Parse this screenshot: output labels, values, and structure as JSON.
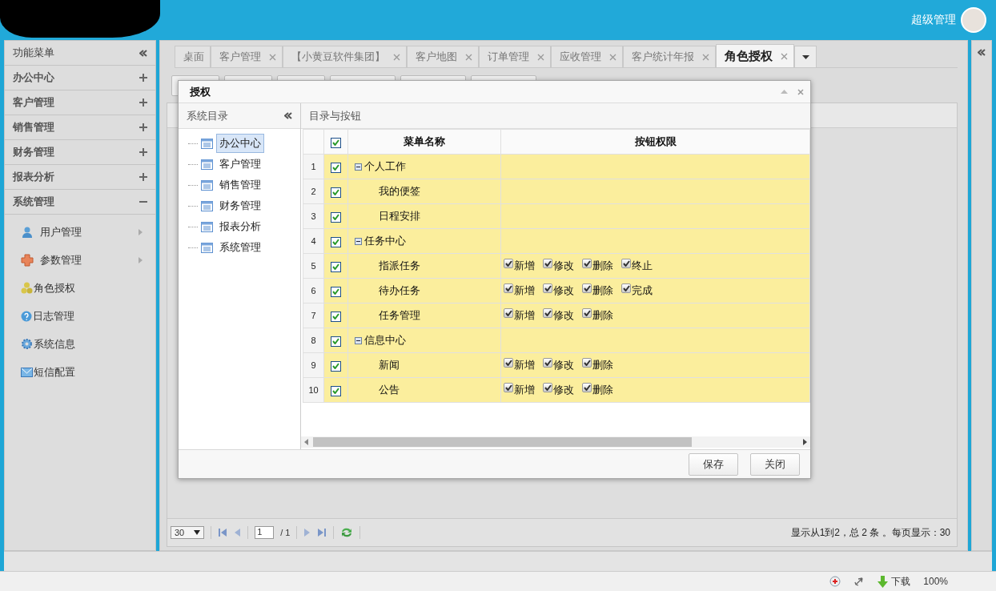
{
  "header": {
    "user": "超级管理"
  },
  "sidebar": {
    "title": "功能菜单",
    "groups": [
      {
        "label": "办公中心",
        "expanded": false
      },
      {
        "label": "客户管理",
        "expanded": false
      },
      {
        "label": "销售管理",
        "expanded": false
      },
      {
        "label": "财务管理",
        "expanded": false
      },
      {
        "label": "报表分析",
        "expanded": false
      },
      {
        "label": "系统管理",
        "expanded": true,
        "items": [
          {
            "label": "用户管理",
            "submenu": true
          },
          {
            "label": "参数管理",
            "submenu": true
          },
          {
            "label": "角色授权",
            "submenu": false
          },
          {
            "label": "日志管理",
            "submenu": false
          },
          {
            "label": "系统信息",
            "submenu": false
          },
          {
            "label": "短信配置",
            "submenu": false
          }
        ]
      }
    ]
  },
  "tabs": [
    {
      "label": "桌面",
      "closable": false,
      "selected": false
    },
    {
      "label": "客户管理",
      "closable": true,
      "selected": false
    },
    {
      "label": "【小黄豆软件集团】",
      "closable": true,
      "selected": false
    },
    {
      "label": "客户地图",
      "closable": true,
      "selected": false
    },
    {
      "label": "订单管理",
      "closable": true,
      "selected": false
    },
    {
      "label": "应收管理",
      "closable": true,
      "selected": false
    },
    {
      "label": "客户统计年报",
      "closable": true,
      "selected": false
    },
    {
      "label": "角色授权",
      "closable": true,
      "selected": true
    }
  ],
  "pager": {
    "page_size": "30",
    "page": "1",
    "total_pages": "/ 1",
    "summary": "显示从1到2，总 2 条 。每页显示：30"
  },
  "dialog": {
    "title": "授权",
    "tree": {
      "title": "系统目录",
      "items": [
        {
          "label": "办公中心",
          "selected": true
        },
        {
          "label": "客户管理",
          "selected": false
        },
        {
          "label": "销售管理",
          "selected": false
        },
        {
          "label": "财务管理",
          "selected": false
        },
        {
          "label": "报表分析",
          "selected": false
        },
        {
          "label": "系统管理",
          "selected": false
        }
      ]
    },
    "grid": {
      "title": "目录与按钮",
      "all_checked": true,
      "columns": [
        "菜单名称",
        "按钮权限"
      ],
      "rows": [
        {
          "number": "1",
          "checked": true,
          "kind": "group",
          "expanded": true,
          "name": "个人工作"
        },
        {
          "number": "2",
          "checked": true,
          "kind": "leaf",
          "name": "我的便签"
        },
        {
          "number": "3",
          "checked": true,
          "kind": "leaf",
          "name": "日程安排"
        },
        {
          "number": "4",
          "checked": true,
          "kind": "group",
          "expanded": true,
          "name": "任务中心"
        },
        {
          "number": "5",
          "checked": true,
          "kind": "leaf",
          "name": "指派任务",
          "buttons": [
            {
              "label": "新增",
              "checked": true
            },
            {
              "label": "修改",
              "checked": true
            },
            {
              "label": "删除",
              "checked": true
            },
            {
              "label": "终止",
              "checked": true
            }
          ]
        },
        {
          "number": "6",
          "checked": true,
          "kind": "leaf",
          "name": "待办任务",
          "buttons": [
            {
              "label": "新增",
              "checked": true
            },
            {
              "label": "修改",
              "checked": true
            },
            {
              "label": "删除",
              "checked": true
            },
            {
              "label": "完成",
              "checked": true
            }
          ]
        },
        {
          "number": "7",
          "checked": true,
          "kind": "leaf",
          "name": "任务管理",
          "buttons": [
            {
              "label": "新增",
              "checked": true
            },
            {
              "label": "修改",
              "checked": true
            },
            {
              "label": "删除",
              "checked": true
            }
          ]
        },
        {
          "number": "8",
          "checked": true,
          "kind": "group",
          "expanded": true,
          "name": "信息中心"
        },
        {
          "number": "9",
          "checked": true,
          "kind": "leaf",
          "name": "新闻",
          "buttons": [
            {
              "label": "新增",
              "checked": true
            },
            {
              "label": "修改",
              "checked": true
            },
            {
              "label": "删除",
              "checked": true
            }
          ]
        },
        {
          "number": "10",
          "checked": true,
          "kind": "leaf",
          "name": "公告",
          "buttons": [
            {
              "label": "新增",
              "checked": true
            },
            {
              "label": "修改",
              "checked": true
            },
            {
              "label": "删除",
              "checked": true
            }
          ]
        }
      ]
    },
    "buttons": [
      "保存",
      "关闭"
    ]
  },
  "status_bar": {
    "download": "下载",
    "zoom": "100%"
  }
}
